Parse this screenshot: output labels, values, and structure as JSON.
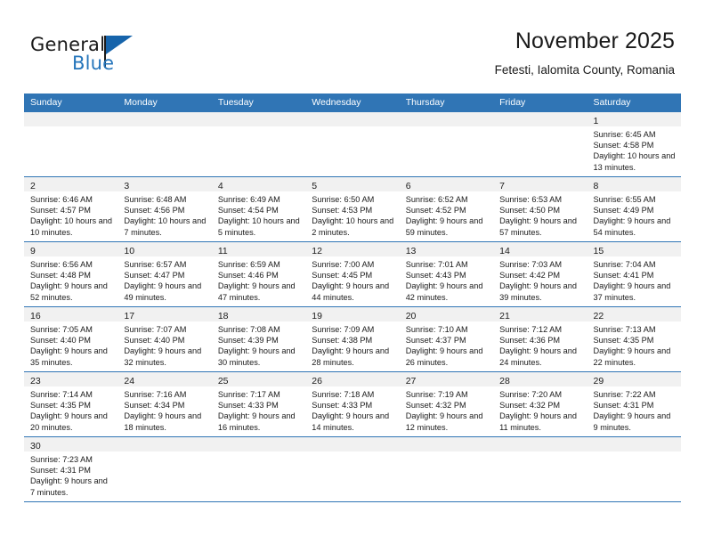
{
  "brand": {
    "name_part1": "General",
    "name_part2": "Blue",
    "triangle_icon": "triangle-icon",
    "accent_color": "#2575bb"
  },
  "header": {
    "title": "November 2025",
    "subtitle": "Fetesti, Ialomita County, Romania"
  },
  "theme": {
    "header_blue": "#3075b5",
    "band_gray": "#f1f1f1",
    "text_dark": "#1a1a1a"
  },
  "weekdays": [
    "Sunday",
    "Monday",
    "Tuesday",
    "Wednesday",
    "Thursday",
    "Friday",
    "Saturday"
  ],
  "weeks": [
    [
      {
        "empty": true
      },
      {
        "empty": true
      },
      {
        "empty": true
      },
      {
        "empty": true
      },
      {
        "empty": true
      },
      {
        "empty": true
      },
      {
        "day": "1",
        "sunrise": "Sunrise: 6:45 AM",
        "sunset": "Sunset: 4:58 PM",
        "daylight": "Daylight: 10 hours and 13 minutes."
      }
    ],
    [
      {
        "day": "2",
        "sunrise": "Sunrise: 6:46 AM",
        "sunset": "Sunset: 4:57 PM",
        "daylight": "Daylight: 10 hours and 10 minutes."
      },
      {
        "day": "3",
        "sunrise": "Sunrise: 6:48 AM",
        "sunset": "Sunset: 4:56 PM",
        "daylight": "Daylight: 10 hours and 7 minutes."
      },
      {
        "day": "4",
        "sunrise": "Sunrise: 6:49 AM",
        "sunset": "Sunset: 4:54 PM",
        "daylight": "Daylight: 10 hours and 5 minutes."
      },
      {
        "day": "5",
        "sunrise": "Sunrise: 6:50 AM",
        "sunset": "Sunset: 4:53 PM",
        "daylight": "Daylight: 10 hours and 2 minutes."
      },
      {
        "day": "6",
        "sunrise": "Sunrise: 6:52 AM",
        "sunset": "Sunset: 4:52 PM",
        "daylight": "Daylight: 9 hours and 59 minutes."
      },
      {
        "day": "7",
        "sunrise": "Sunrise: 6:53 AM",
        "sunset": "Sunset: 4:50 PM",
        "daylight": "Daylight: 9 hours and 57 minutes."
      },
      {
        "day": "8",
        "sunrise": "Sunrise: 6:55 AM",
        "sunset": "Sunset: 4:49 PM",
        "daylight": "Daylight: 9 hours and 54 minutes."
      }
    ],
    [
      {
        "day": "9",
        "sunrise": "Sunrise: 6:56 AM",
        "sunset": "Sunset: 4:48 PM",
        "daylight": "Daylight: 9 hours and 52 minutes."
      },
      {
        "day": "10",
        "sunrise": "Sunrise: 6:57 AM",
        "sunset": "Sunset: 4:47 PM",
        "daylight": "Daylight: 9 hours and 49 minutes."
      },
      {
        "day": "11",
        "sunrise": "Sunrise: 6:59 AM",
        "sunset": "Sunset: 4:46 PM",
        "daylight": "Daylight: 9 hours and 47 minutes."
      },
      {
        "day": "12",
        "sunrise": "Sunrise: 7:00 AM",
        "sunset": "Sunset: 4:45 PM",
        "daylight": "Daylight: 9 hours and 44 minutes."
      },
      {
        "day": "13",
        "sunrise": "Sunrise: 7:01 AM",
        "sunset": "Sunset: 4:43 PM",
        "daylight": "Daylight: 9 hours and 42 minutes."
      },
      {
        "day": "14",
        "sunrise": "Sunrise: 7:03 AM",
        "sunset": "Sunset: 4:42 PM",
        "daylight": "Daylight: 9 hours and 39 minutes."
      },
      {
        "day": "15",
        "sunrise": "Sunrise: 7:04 AM",
        "sunset": "Sunset: 4:41 PM",
        "daylight": "Daylight: 9 hours and 37 minutes."
      }
    ],
    [
      {
        "day": "16",
        "sunrise": "Sunrise: 7:05 AM",
        "sunset": "Sunset: 4:40 PM",
        "daylight": "Daylight: 9 hours and 35 minutes."
      },
      {
        "day": "17",
        "sunrise": "Sunrise: 7:07 AM",
        "sunset": "Sunset: 4:40 PM",
        "daylight": "Daylight: 9 hours and 32 minutes."
      },
      {
        "day": "18",
        "sunrise": "Sunrise: 7:08 AM",
        "sunset": "Sunset: 4:39 PM",
        "daylight": "Daylight: 9 hours and 30 minutes."
      },
      {
        "day": "19",
        "sunrise": "Sunrise: 7:09 AM",
        "sunset": "Sunset: 4:38 PM",
        "daylight": "Daylight: 9 hours and 28 minutes."
      },
      {
        "day": "20",
        "sunrise": "Sunrise: 7:10 AM",
        "sunset": "Sunset: 4:37 PM",
        "daylight": "Daylight: 9 hours and 26 minutes."
      },
      {
        "day": "21",
        "sunrise": "Sunrise: 7:12 AM",
        "sunset": "Sunset: 4:36 PM",
        "daylight": "Daylight: 9 hours and 24 minutes."
      },
      {
        "day": "22",
        "sunrise": "Sunrise: 7:13 AM",
        "sunset": "Sunset: 4:35 PM",
        "daylight": "Daylight: 9 hours and 22 minutes."
      }
    ],
    [
      {
        "day": "23",
        "sunrise": "Sunrise: 7:14 AM",
        "sunset": "Sunset: 4:35 PM",
        "daylight": "Daylight: 9 hours and 20 minutes."
      },
      {
        "day": "24",
        "sunrise": "Sunrise: 7:16 AM",
        "sunset": "Sunset: 4:34 PM",
        "daylight": "Daylight: 9 hours and 18 minutes."
      },
      {
        "day": "25",
        "sunrise": "Sunrise: 7:17 AM",
        "sunset": "Sunset: 4:33 PM",
        "daylight": "Daylight: 9 hours and 16 minutes."
      },
      {
        "day": "26",
        "sunrise": "Sunrise: 7:18 AM",
        "sunset": "Sunset: 4:33 PM",
        "daylight": "Daylight: 9 hours and 14 minutes."
      },
      {
        "day": "27",
        "sunrise": "Sunrise: 7:19 AM",
        "sunset": "Sunset: 4:32 PM",
        "daylight": "Daylight: 9 hours and 12 minutes."
      },
      {
        "day": "28",
        "sunrise": "Sunrise: 7:20 AM",
        "sunset": "Sunset: 4:32 PM",
        "daylight": "Daylight: 9 hours and 11 minutes."
      },
      {
        "day": "29",
        "sunrise": "Sunrise: 7:22 AM",
        "sunset": "Sunset: 4:31 PM",
        "daylight": "Daylight: 9 hours and 9 minutes."
      }
    ],
    [
      {
        "day": "30",
        "sunrise": "Sunrise: 7:23 AM",
        "sunset": "Sunset: 4:31 PM",
        "daylight": "Daylight: 9 hours and 7 minutes."
      },
      {
        "empty": true
      },
      {
        "empty": true
      },
      {
        "empty": true
      },
      {
        "empty": true
      },
      {
        "empty": true
      },
      {
        "empty": true
      }
    ]
  ]
}
